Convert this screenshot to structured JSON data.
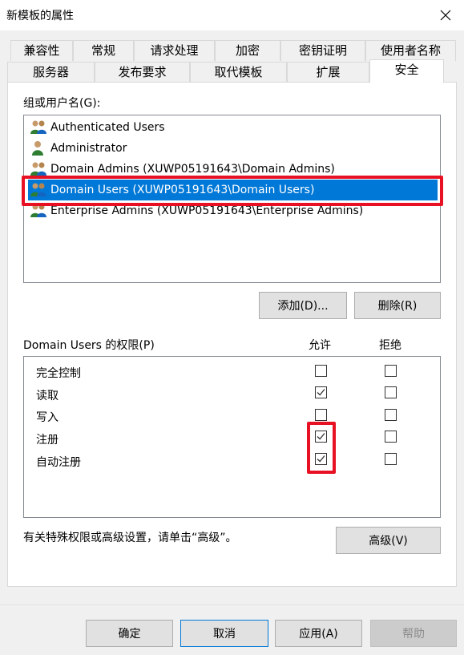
{
  "window": {
    "title": "新模板的属性"
  },
  "tabs_row1": [
    "兼容性",
    "常规",
    "请求处理",
    "加密",
    "密钥证明",
    "使用者名称"
  ],
  "tabs_row2": [
    "服务器",
    "发布要求",
    "取代模板",
    "扩展",
    "安全"
  ],
  "active_tab": "安全",
  "groups_label": "组或用户名(G):",
  "users": [
    {
      "name": "Authenticated Users",
      "icon": "group-icon",
      "selected": false
    },
    {
      "name": "Administrator",
      "icon": "user-icon",
      "selected": false
    },
    {
      "name": "Domain Admins (XUWP05191643\\Domain Admins)",
      "icon": "group-icon",
      "selected": false
    },
    {
      "name": "Domain Users (XUWP05191643\\Domain Users)",
      "icon": "group-icon",
      "selected": true
    },
    {
      "name": "Enterprise Admins (XUWP05191643\\Enterprise Admins)",
      "icon": "group-icon",
      "selected": false
    }
  ],
  "buttons": {
    "add": "添加(D)...",
    "remove": "删除(R)",
    "advanced": "高级(V)",
    "ok": "确定",
    "cancel": "取消",
    "apply": "应用(A)",
    "help": "帮助"
  },
  "permissions": {
    "header": "Domain Users 的权限(P)",
    "allow_label": "允许",
    "deny_label": "拒绝",
    "rows": [
      {
        "name": "完全控制",
        "allow": false,
        "deny": false
      },
      {
        "name": "读取",
        "allow": true,
        "deny": false
      },
      {
        "name": "写入",
        "allow": false,
        "deny": false
      },
      {
        "name": "注册",
        "allow": true,
        "deny": false
      },
      {
        "name": "自动注册",
        "allow": true,
        "deny": false
      }
    ]
  },
  "advanced_hint": "有关特殊权限或高级设置，请单击“高级”。",
  "colors": {
    "selection": "#0078d7",
    "highlight_frame": "#e81123"
  }
}
